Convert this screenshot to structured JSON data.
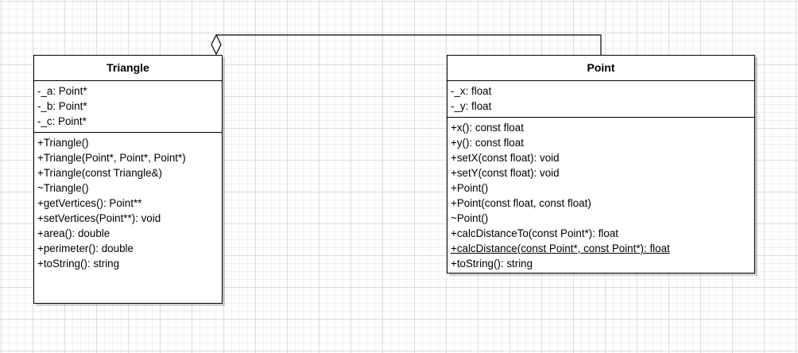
{
  "diagram": {
    "classes": [
      {
        "id": "triangle",
        "name": "Triangle",
        "attributes": [
          {
            "text": "-_a: Point*"
          },
          {
            "text": "-_b: Point*"
          },
          {
            "text": "-_c: Point*"
          }
        ],
        "methods": [
          {
            "text": "+Triangle()"
          },
          {
            "text": "+Triangle(Point*, Point*, Point*)"
          },
          {
            "text": "+Triangle(const Triangle&)"
          },
          {
            "text": "~Triangle()"
          },
          {
            "text": "+getVertices(): Point**"
          },
          {
            "text": "+setVertices(Point**): void"
          },
          {
            "text": "+area(): double"
          },
          {
            "text": "+perimeter(): double"
          },
          {
            "text": "+toString(): string"
          }
        ]
      },
      {
        "id": "point",
        "name": "Point",
        "attributes": [
          {
            "text": "-_x: float"
          },
          {
            "text": "-_y: float"
          }
        ],
        "methods": [
          {
            "text": "+x(): const float"
          },
          {
            "text": "+y(): const float"
          },
          {
            "text": "+setX(const float): void"
          },
          {
            "text": "+setY(const float): void"
          },
          {
            "text": "+Point()"
          },
          {
            "text": "+Point(const float, const float)"
          },
          {
            "text": "~Point()"
          },
          {
            "text": "+calcDistanceTo(const Point*): float"
          },
          {
            "text": "+calcDistance(const Point*, const Point*): float",
            "static": true
          },
          {
            "text": "+toString(): string"
          }
        ]
      }
    ],
    "relationship": {
      "type": "aggregation",
      "whole": "Triangle",
      "part": "Point"
    }
  }
}
